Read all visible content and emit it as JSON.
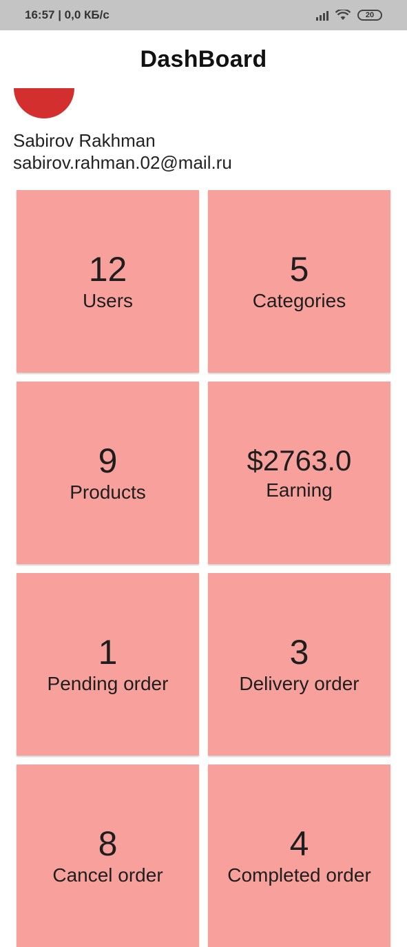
{
  "status_bar": {
    "time_speed": "16:57 | 0,0 КБ/с",
    "battery": "20"
  },
  "app_bar": {
    "title": "DashBoard"
  },
  "profile": {
    "name": "Sabirov Rakhman",
    "email": "sabirov.rahman.02@mail.ru"
  },
  "cards": [
    {
      "value": "12",
      "label": "Users"
    },
    {
      "value": "5",
      "label": "Categories"
    },
    {
      "value": "9",
      "label": "Products"
    },
    {
      "value": "$2763.0",
      "label": "Earning"
    },
    {
      "value": "1",
      "label": "Pending order"
    },
    {
      "value": "3",
      "label": "Delivery order"
    },
    {
      "value": "8",
      "label": "Cancel order"
    },
    {
      "value": "4",
      "label": "Completed order"
    }
  ],
  "colors": {
    "card_background": "#f8a19c",
    "avatar": "#d32f2f",
    "status_bar": "#c4c4c4"
  }
}
